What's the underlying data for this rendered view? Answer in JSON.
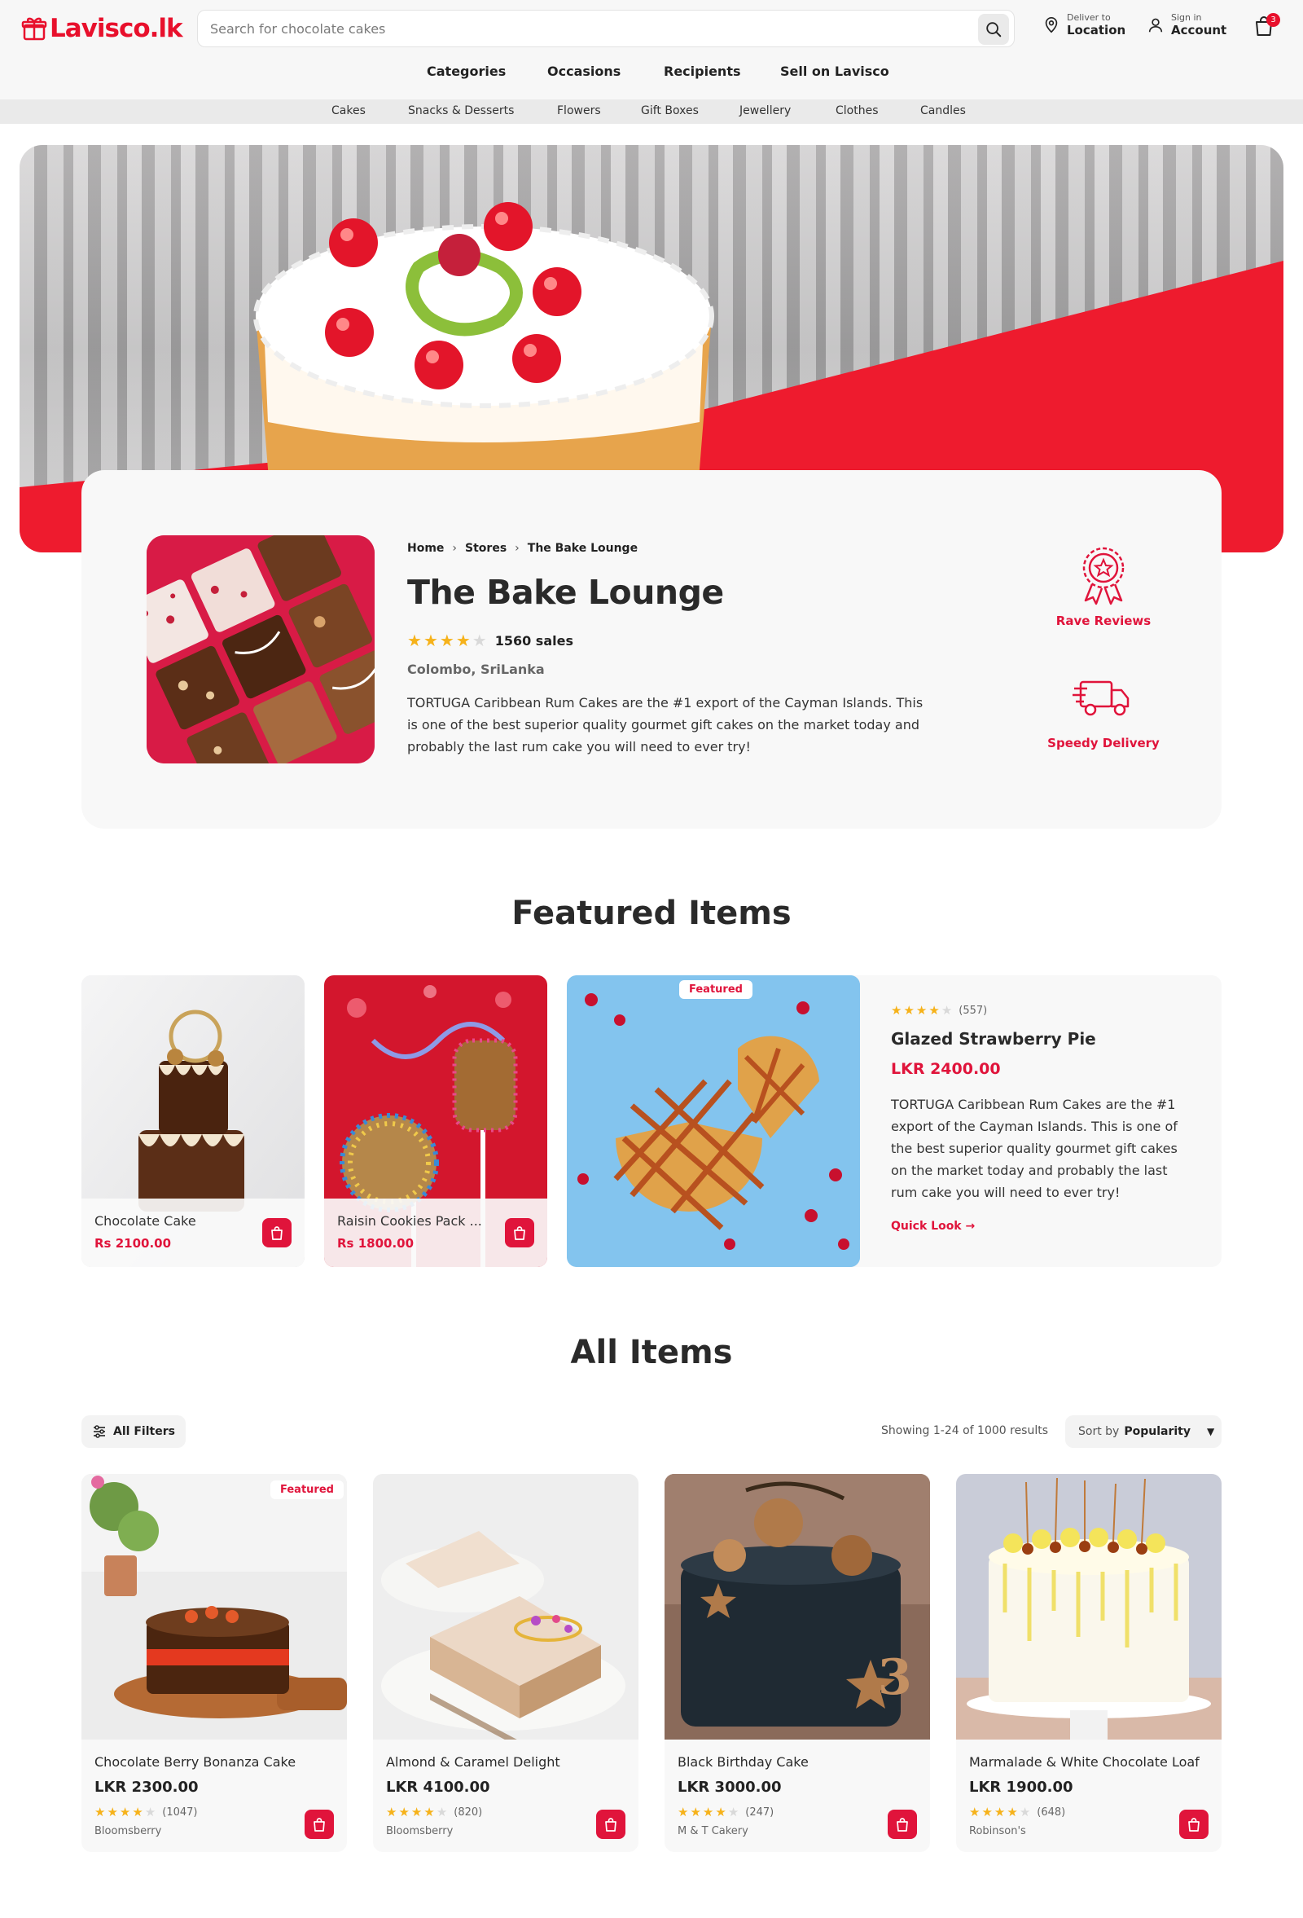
{
  "brand": {
    "name": "Lavisco.lk",
    "accent": "#e8102c"
  },
  "search": {
    "placeholder": "Search for chocolate cakes"
  },
  "header": {
    "deliver_small": "Deliver to",
    "deliver_big": "Location",
    "account_small": "Sign in",
    "account_big": "Account",
    "cart_count": "3"
  },
  "main_nav": [
    "Categories",
    "Occasions",
    "Recipients",
    "Sell on Lavisco"
  ],
  "sub_nav": [
    "Cakes",
    "Snacks & Desserts",
    "Flowers",
    "Gift Boxes",
    "Jewellery",
    "Clothes",
    "Candles"
  ],
  "store": {
    "breadcrumb": [
      "Home",
      "Stores",
      "The Bake Lounge"
    ],
    "name": "The Bake Lounge",
    "rating": 4,
    "sales": "1560 sales",
    "location": "Colombo, SriLanka",
    "description": "TORTUGA Caribbean Rum Cakes are the #1 export of the Cayman Islands. This is one of the best superior quality gourmet gift cakes on the market today and probably the last rum cake you will need to ever try!",
    "badges": [
      {
        "icon": "award-ribbon-icon",
        "label": "Rave Reviews"
      },
      {
        "icon": "delivery-truck-icon",
        "label": "Speedy Delivery"
      }
    ]
  },
  "featured": {
    "title": "Featured Items",
    "cards": [
      {
        "name": "Chocolate Cake",
        "price": "Rs 2100.00"
      },
      {
        "name": "Raisin Cookies Pack ...",
        "price": "Rs 1800.00"
      }
    ],
    "highlight": {
      "tag": "Featured",
      "rating": 4,
      "reviews": "(557)",
      "name": "Glazed Strawberry Pie",
      "price": "LKR 2400.00",
      "description": "TORTUGA Caribbean Rum Cakes are the #1 export of the Cayman Islands. This is one of the best superior quality gourmet gift cakes on the market today and probably the last rum cake you will need to ever try!",
      "quick_look": "Quick Look"
    }
  },
  "all_items": {
    "title": "All Items",
    "filters_label": "All Filters",
    "showing": "Showing 1-24 of 1000 results",
    "sort_prefix": "Sort by",
    "sort_value": "Popularity",
    "items": [
      {
        "name": "Chocolate Berry Bonanza Cake",
        "price": "LKR 2300.00",
        "rating": 4,
        "reviews": "(1047)",
        "store": "Bloomsberry",
        "tag": "Featured"
      },
      {
        "name": "Almond & Caramel Delight",
        "price": "LKR 4100.00",
        "rating": 4,
        "reviews": "(820)",
        "store": "Bloomsberry",
        "tag": ""
      },
      {
        "name": "Black Birthday Cake",
        "price": "LKR 3000.00",
        "rating": 4,
        "reviews": "(247)",
        "store": "M & T Cakery",
        "tag": ""
      },
      {
        "name": "Marmalade & White Chocolate Loaf",
        "price": "LKR 1900.00",
        "rating": 4,
        "reviews": "(648)",
        "store": "Robinson's",
        "tag": ""
      }
    ]
  }
}
